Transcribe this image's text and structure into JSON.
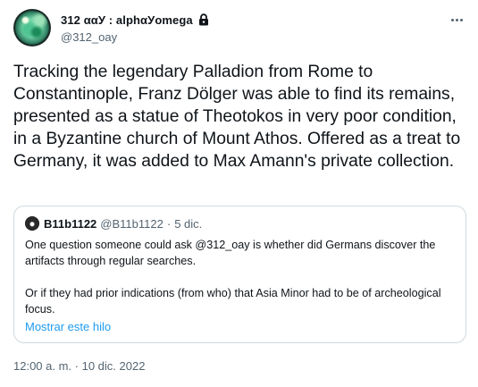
{
  "tweet": {
    "author": {
      "display_name": "312 ααУ : alphαУomega",
      "handle": "@312_oay",
      "avatar_icon": "planet-avatar",
      "protected_icon": "lock-icon"
    },
    "more_icon": "more-options-icon",
    "text": "Tracking the legendary Palladion from Rome to Constantinople, Franz Dölger was able to find its remains, presented as a statue of Theotokos in very poor condition, in a Byzantine church of Mount Athos. Offered as a treat to Germany, it was added to Max Amann's private collection.",
    "timestamp": "12:00 a. m. · 10 dic. 2022"
  },
  "quote": {
    "author_name": "B11b1122",
    "author_handle": "@B11b1122",
    "separator": "·",
    "date": "5 dic.",
    "paragraphs": [
      "One question someone could ask @312_oay is whether did Germans discover the artifacts through regular searches.",
      "Or if they had prior indications (from who) that Asia Minor had to be of archeological focus."
    ],
    "show_thread_label": "Mostrar este hilo"
  },
  "colors": {
    "text_primary": "#0f1419",
    "text_secondary": "#536471",
    "link": "#1d9bf0",
    "border": "#cfd9de"
  }
}
